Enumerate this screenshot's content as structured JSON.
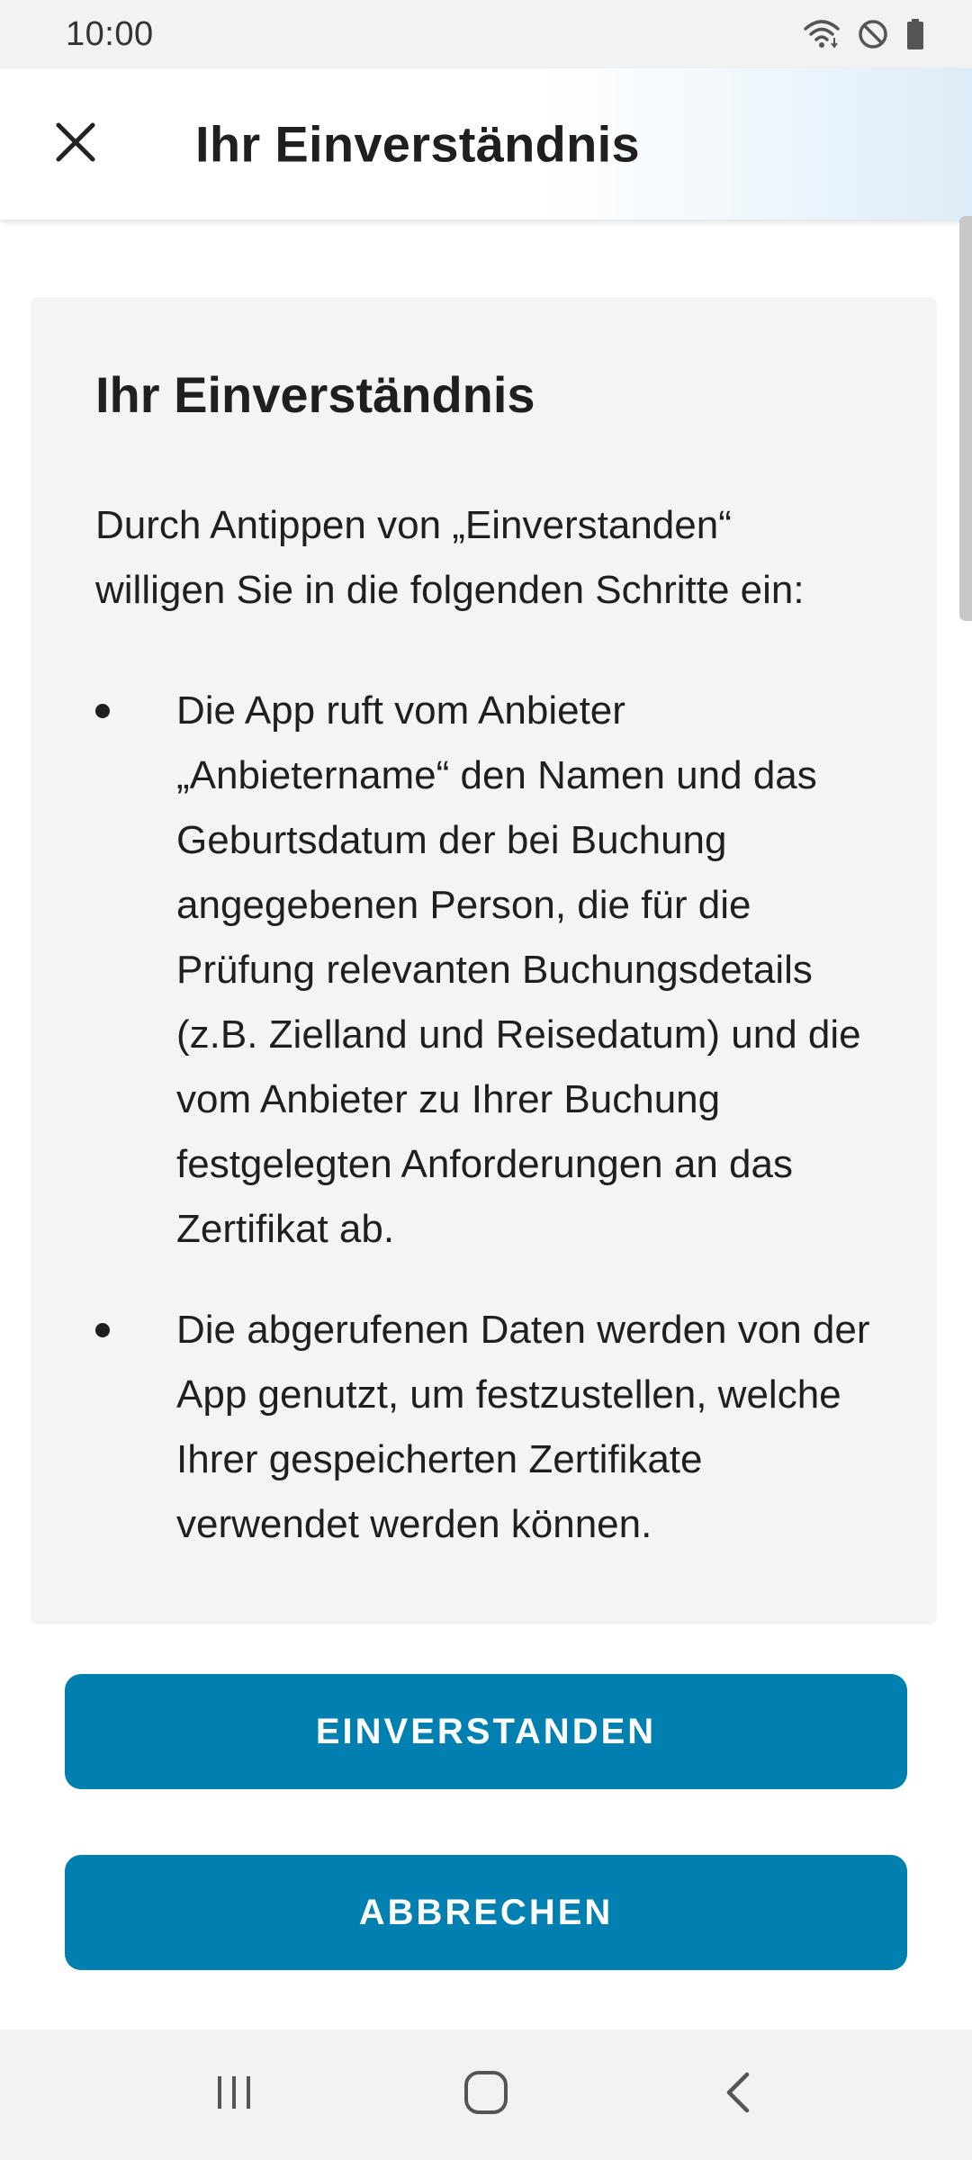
{
  "status_bar": {
    "time": "10:00",
    "icons": [
      "wifi-icon",
      "do-not-disturb-icon",
      "battery-icon"
    ]
  },
  "app_bar": {
    "title": "Ihr Einverständnis",
    "close_icon": "close-icon"
  },
  "content": {
    "heading": "Ihr Einverständnis",
    "intro": "Durch Antippen von „Einverstanden“ willigen Sie in die folgenden Schritte ein:",
    "bullets": [
      "Die App ruft vom Anbieter „Anbietername“ den Namen und das Geburtsdatum der bei Buchung angegebenen Person, die für die Prüfung relevanten Buchungsdetails (z.B. Zielland und Reisedatum) und die vom Anbieter zu Ihrer Buchung festgelegten Anforderungen an das Zertifikat ab.",
      "Die abgerufenen Daten werden von der App genutzt, um festzustellen, welche Ihrer gespeicherten Zertifikate verwendet werden können."
    ]
  },
  "actions": {
    "agree_label": "EINVERSTANDEN",
    "cancel_label": "ABBRECHEN"
  },
  "nav_bar": {
    "items": [
      "recent-apps-icon",
      "home-icon",
      "back-icon"
    ]
  },
  "colors": {
    "primary": "#0080b0",
    "card_background": "#f4f4f4",
    "text": "#1f1f1f"
  }
}
